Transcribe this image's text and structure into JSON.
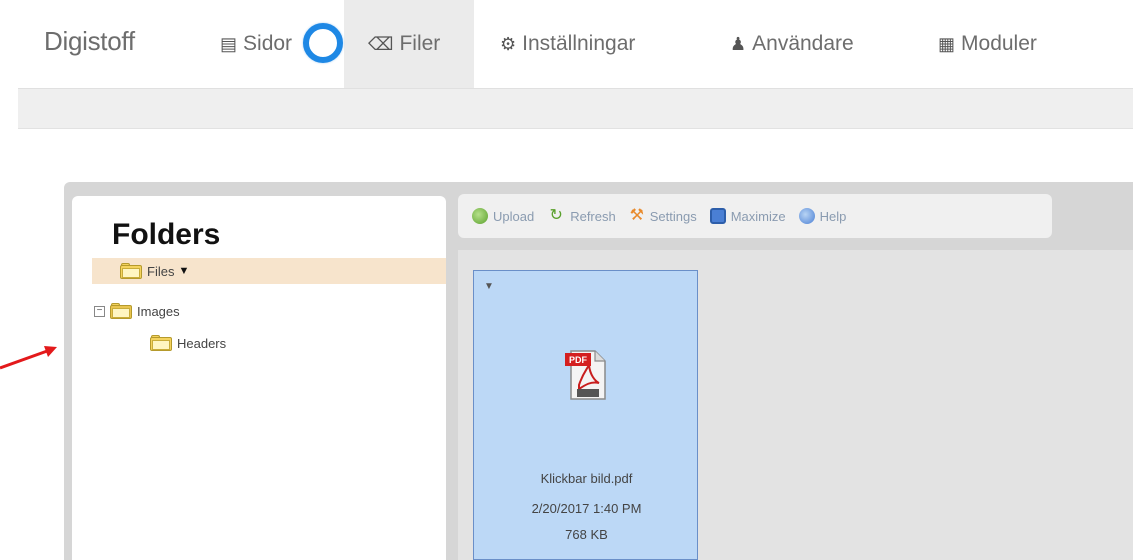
{
  "brand": "Digistoff",
  "nav": {
    "sidor": {
      "label": "Sidor",
      "icon": "pages-icon"
    },
    "filer": {
      "label": "Filer",
      "icon": "files-icon"
    },
    "installningar": {
      "label": "Inställningar",
      "icon": "gears-icon"
    },
    "anvandare": {
      "label": "Användare",
      "icon": "user-icon"
    },
    "moduler": {
      "label": "Moduler",
      "icon": "grid-icon"
    }
  },
  "folders": {
    "title": "Folders",
    "tree": [
      {
        "label": "Files",
        "selected": true
      },
      {
        "label": "Images",
        "expanded": true
      },
      {
        "label": "Headers"
      }
    ]
  },
  "toolbar": {
    "upload": "Upload",
    "refresh": "Refresh",
    "settings": "Settings",
    "maximize": "Maximize",
    "help": "Help"
  },
  "file": {
    "name": "Klickbar bild.pdf",
    "date": "2/20/2017 1:40 PM",
    "size": "768 KB",
    "type_label": "PDF",
    "icon": "pdf-icon"
  },
  "colors": {
    "loader": "#1e88e5",
    "active_tab": "#ebebeb",
    "selection": "#bcd8f6",
    "arrow": "#e3191b"
  }
}
